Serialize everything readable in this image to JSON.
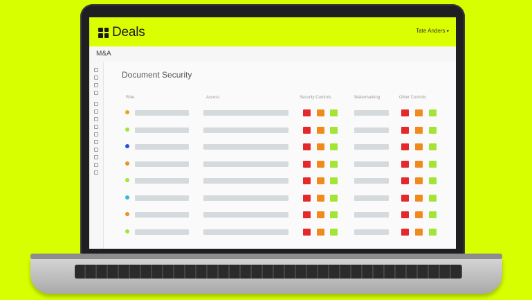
{
  "app": {
    "brand": "Deals",
    "user_menu": "Tate Anders",
    "breadcrumb": "M&A"
  },
  "page": {
    "title": "Document Security"
  },
  "table": {
    "columns": [
      "Role",
      "Access",
      "Security Controls",
      "Watermarking",
      "Other Controls"
    ],
    "rows": [
      {
        "dot_color": "#f0a21c"
      },
      {
        "dot_color": "#a8e23a"
      },
      {
        "dot_color": "#2254e0"
      },
      {
        "dot_color": "#f09020"
      },
      {
        "dot_color": "#a8e23a"
      },
      {
        "dot_color": "#35b8d8"
      },
      {
        "dot_color": "#f09020"
      },
      {
        "dot_color": "#a8e23a"
      }
    ]
  },
  "colors": {
    "background": "#d7ff00",
    "header": "#d9ff00",
    "control_red": "#e3292b",
    "control_orange": "#f08a1d",
    "control_green": "#a4e437"
  },
  "icons": {
    "brand": "grid-logo-icon",
    "user_menu": "chevron-down-icon"
  }
}
